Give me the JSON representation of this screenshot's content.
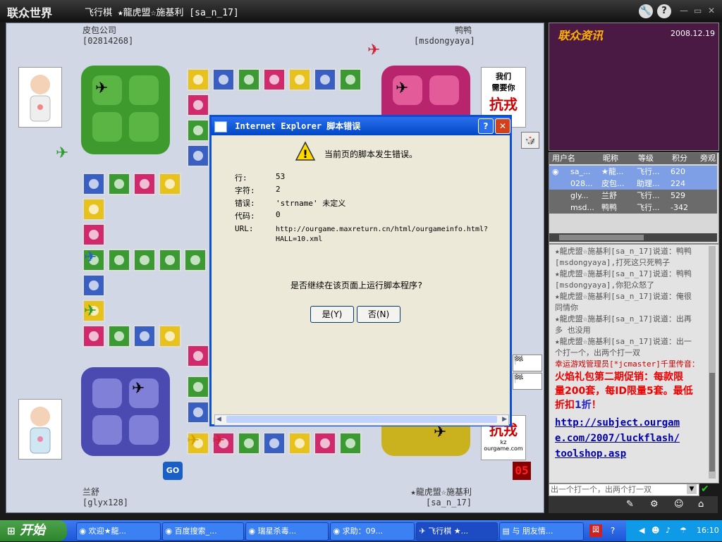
{
  "titlebar": {
    "logo": "联众世界",
    "title": "飞行棋 ★龍虎盟☆施基利 [sa_n_17]"
  },
  "players": {
    "top_left": {
      "name": "皮包公司",
      "id": "[02814268]"
    },
    "top_right": {
      "name": "鸭鸭",
      "id": "[msdongyaya]"
    },
    "bottom_left": {
      "name": "兰舒",
      "id": "[glyx128]"
    },
    "bottom_right": {
      "name": "★龍虎盟☆施基利",
      "id": "[sa_n_17]"
    }
  },
  "ads": {
    "top": {
      "line1": "我们",
      "line2": "需要你",
      "big": "抗戎"
    },
    "bottom": {
      "big": "抗戎",
      "line1": "kz",
      "line2": "ourgame.com"
    }
  },
  "board_buttons": {
    "go_label": "GO",
    "counter": "05"
  },
  "dialog": {
    "title": "Internet Explorer 脚本错误",
    "message": "当前页的脚本发生错误。",
    "rows": [
      {
        "label": "行:",
        "value": "53"
      },
      {
        "label": "字符:",
        "value": "2"
      },
      {
        "label": "错误:",
        "value": "'strname' 未定义"
      },
      {
        "label": "代码:",
        "value": "0"
      },
      {
        "label": "URL:",
        "value": "http://ourgame.maxreturn.cn/html/ourgameinfo.html?"
      }
    ],
    "url_cont": "HALL=10.xml",
    "question": "是否继续在该页面上运行脚本程序?",
    "yes_label": "是(Y)",
    "no_label": "否(N)",
    "help": "?",
    "close": "✕"
  },
  "news": {
    "title": "联众资讯",
    "date": "2008.12.19"
  },
  "users": {
    "headers": [
      "用户名",
      "昵称",
      "等级",
      "积分",
      "旁观"
    ],
    "rows": [
      {
        "user": "sa_...",
        "nick": "★龍...",
        "level": "飞行...",
        "score": "620"
      },
      {
        "user": "028...",
        "nick": "皮包...",
        "level": "助理...",
        "score": "224"
      },
      {
        "user": "gly...",
        "nick": "兰舒",
        "level": "飞行...",
        "score": "529"
      },
      {
        "user": "msd...",
        "nick": "鸭鸭",
        "level": "飞行...",
        "score": "-342"
      }
    ]
  },
  "chat": {
    "lines": [
      "★龍虎盟☆施基利[sa_n_17]说道：鸭鸭",
      "[msdongyaya],打死这只死鸭子",
      "★龍虎盟☆施基利[sa_n_17]说道：鸭鸭",
      "[msdongyaya],你犯众怒了",
      "★龍虎盟☆施基利[sa_n_17]说道：俺很",
      "同情你",
      "★龍虎盟☆施基利[sa_n_17]说道：出再",
      "多  也没用",
      "★龍虎盟☆施基利[sa_n_17]说道：出一",
      "个打一个，出两个打一双"
    ],
    "admin": "幸运游戏管理员[*jcmaster]千里传音：",
    "promo1": "火焰礼包第二期促销：每款限",
    "promo2": "量200套，每ID限量5套。最低",
    "promo3a": "折扣",
    "promo3b": "1折",
    "promo3c": "！",
    "link1": "http://subject.ourgam",
    "link2": "e.com/2007/luckflash/",
    "link3": "toolshop.asp",
    "input": "出一个打一个，出两个打一双"
  },
  "taskbar": {
    "start": "开始",
    "tasks": [
      "欢迎★龍...",
      "百度搜索_...",
      "瑞星杀毒...",
      "求助：09...",
      "飞行棋 ★...",
      "与 朋友情..."
    ],
    "clock": "16:10"
  },
  "colors": {
    "dialog_title": "#0a4fd8",
    "taskbar": "#245edb",
    "start": "#3a993a",
    "news_bg": "#4a1a45",
    "news_title": "#ffb000"
  }
}
